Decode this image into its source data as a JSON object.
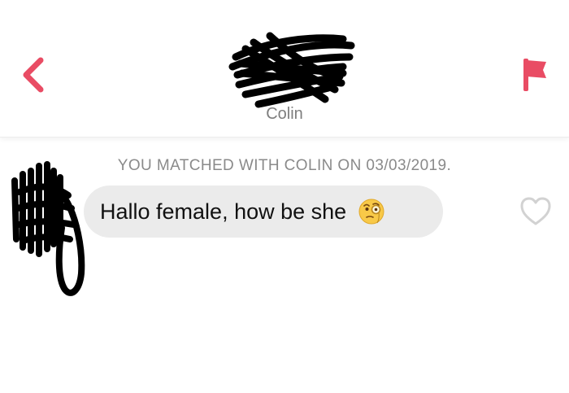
{
  "header": {
    "match_name": "Colin",
    "back_icon": "chevron-left-icon",
    "report_icon": "flag-icon",
    "accent_color": "#e94c64"
  },
  "conversation": {
    "match_notice": "YOU MATCHED WITH COLIN ON 03/03/2019.",
    "messages": [
      {
        "text": "Hallo female, how be she",
        "emoji": "face-with-monocle-icon",
        "liked": false
      }
    ]
  },
  "colors": {
    "bubble_background": "#ebebeb",
    "notice_text": "#8a8a8a",
    "redaction": "#000000"
  }
}
